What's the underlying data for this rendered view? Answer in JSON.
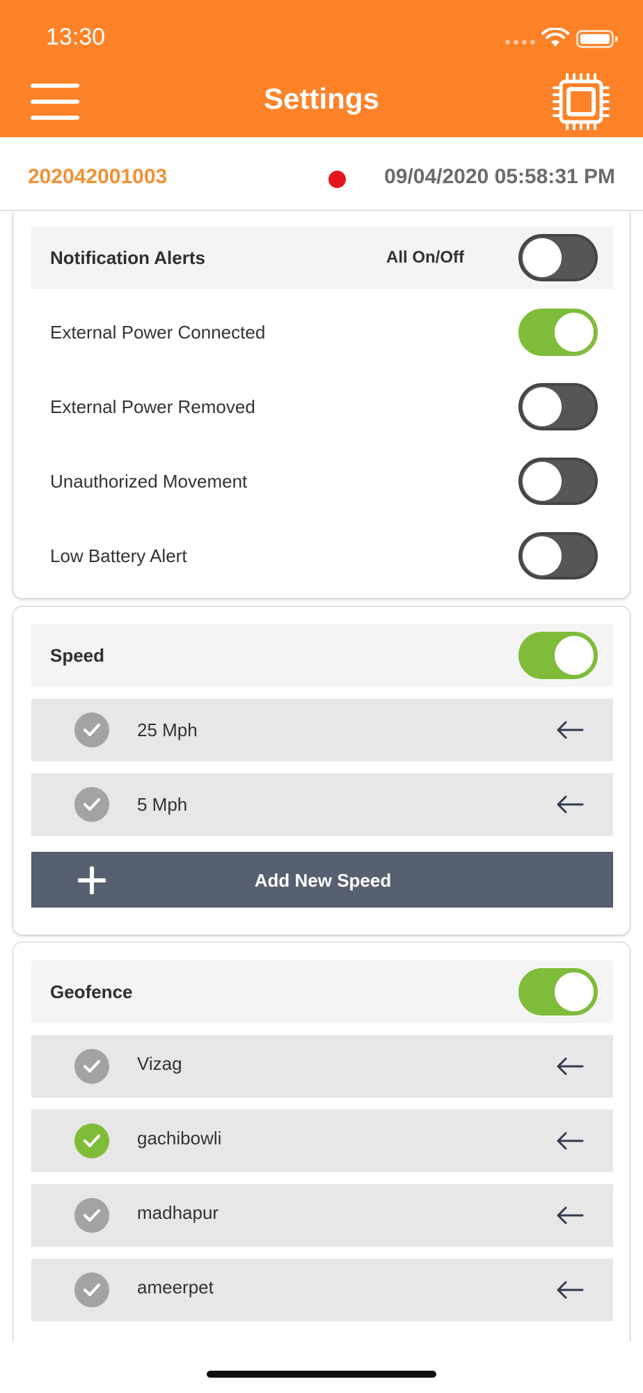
{
  "status_bar": {
    "time": "13:30"
  },
  "header": {
    "title": "Settings",
    "menu_icon": "hamburger-menu-icon",
    "device_icon": "chip-icon"
  },
  "device": {
    "id": "202042001003",
    "status_color": "#e3141e",
    "timestamp": "09/04/2020 05:58:31 PM"
  },
  "notifications": {
    "title": "Notification Alerts",
    "all_label": "All On/Off",
    "all_on": false,
    "items": [
      {
        "label": "External Power Connected",
        "on": true
      },
      {
        "label": "External Power Removed",
        "on": false
      },
      {
        "label": "Unauthorized Movement",
        "on": false
      },
      {
        "label": "Low Battery Alert",
        "on": false
      }
    ]
  },
  "speed": {
    "title": "Speed",
    "on": true,
    "items": [
      {
        "label": "25 Mph",
        "checked": false
      },
      {
        "label": "5 Mph",
        "checked": false
      }
    ],
    "add_label": "Add New Speed"
  },
  "geofence": {
    "title": "Geofence",
    "on": true,
    "items": [
      {
        "label": "Vizag",
        "checked": false
      },
      {
        "label": "gachibowli",
        "checked": true
      },
      {
        "label": "madhapur",
        "checked": false
      },
      {
        "label": "ameerpet",
        "checked": false
      }
    ]
  },
  "colors": {
    "brand": "#fd8228",
    "toggle_on": "#7fbc3a",
    "toggle_off": "#565656",
    "button": "#566070"
  }
}
